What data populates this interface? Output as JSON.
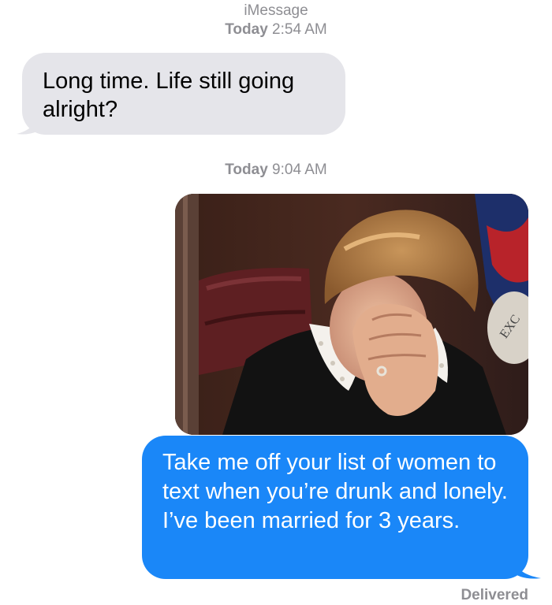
{
  "header": {
    "service": "iMessage",
    "first_time": {
      "day": "Today",
      "time": "2:54 AM"
    }
  },
  "messages": [
    {
      "direction": "incoming",
      "text": "Long time. Life still going alright?"
    },
    {
      "direction": "outgoing",
      "type": "image"
    },
    {
      "direction": "outgoing",
      "text": "Take me off your list of women to text when you’re drunk and lonely. I’ve been married for 3 years."
    }
  ],
  "second_time": {
    "day": "Today",
    "time": "9:04 AM"
  },
  "status": "Delivered",
  "colors": {
    "incoming_bubble": "#e5e5ea",
    "outgoing_bubble": "#1a87f8",
    "meta_text": "#8e8e93"
  }
}
